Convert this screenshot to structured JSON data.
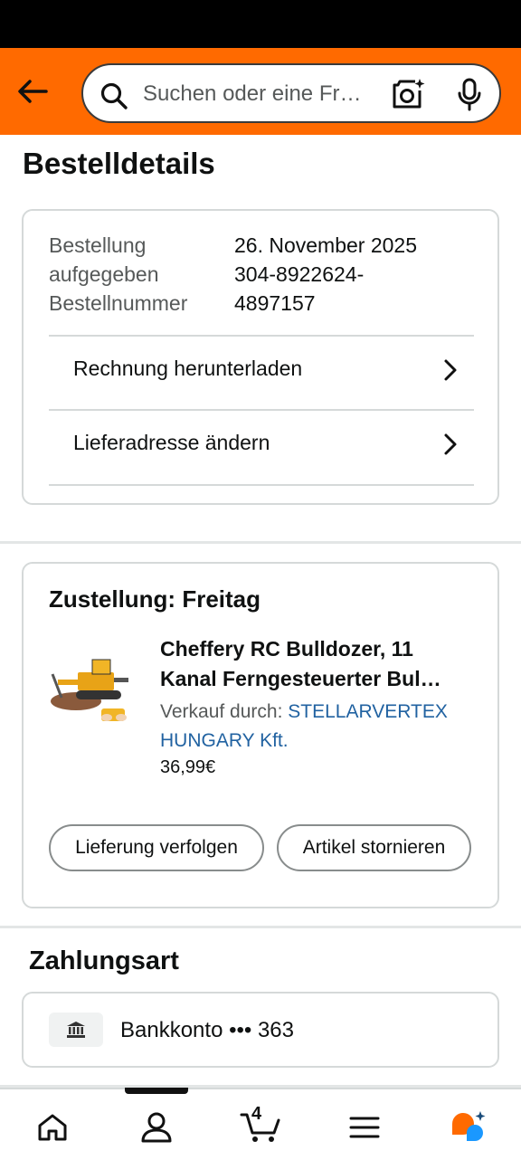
{
  "header": {
    "search_placeholder": "Suchen oder eine Fr…"
  },
  "page": {
    "title": "Bestelldetails"
  },
  "order_info": {
    "label_line1": "Bestellung",
    "label_line2": "aufgegeben",
    "label_line3": "Bestellnummer",
    "date": "26. November 2025",
    "number_line1": "304-8922624-",
    "number_line2": "4897157",
    "links": [
      {
        "label": "Rechnung herunterladen"
      },
      {
        "label": "Lieferadresse ändern"
      }
    ]
  },
  "shipment": {
    "title": "Zustellung: Freitag",
    "product": {
      "title_line1": "Cheffery RC Bulldozer, 11",
      "title_line2": "Kanal Ferngesteuerter Bul…",
      "seller_prefix": "Verkauf durch:",
      "seller_name_line1": "STELLARVERTEX",
      "seller_name_line2": "HUNGARY Kft.",
      "price": "36,99€"
    },
    "track_label": "Lieferung verfolgen",
    "cancel_label": "Artikel stornieren"
  },
  "payment": {
    "title": "Zahlungsart",
    "method": "Bankkonto ••• 363"
  },
  "nav": {
    "cart_count": "4"
  },
  "colors": {
    "header_bg": "#ff6a00",
    "link": "#2162a1"
  }
}
